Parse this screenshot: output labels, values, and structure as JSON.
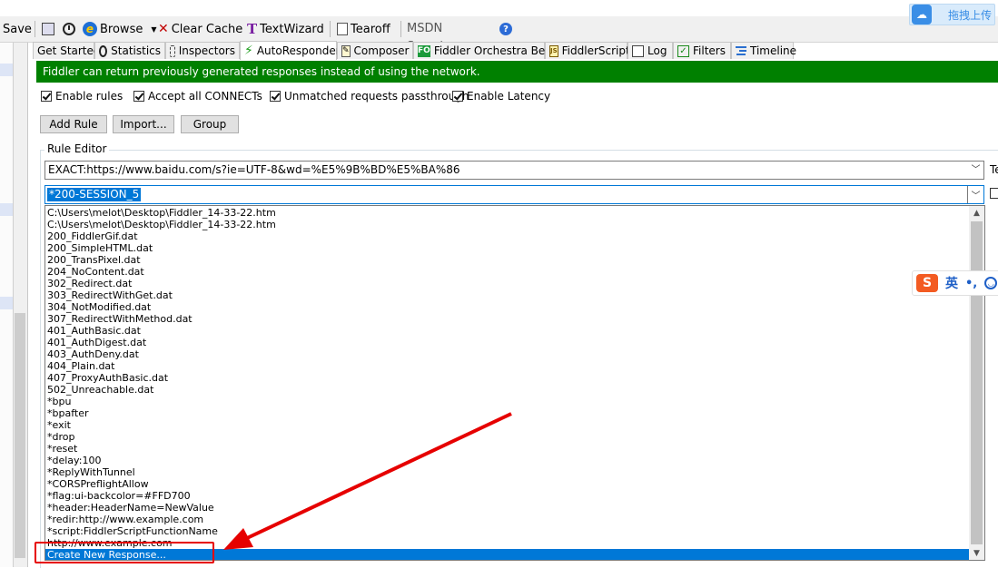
{
  "toolbar": {
    "save_label": "Save",
    "browse_label": "Browse",
    "clear_cache_label": "Clear Cache",
    "textwizard_label": "TextWizard",
    "tearoff_label": "Tearoff",
    "msdn_placeholder": "MSDN Search..."
  },
  "upload_label": "拖拽上传",
  "tabs": [
    {
      "label": "Get Started"
    },
    {
      "label": "Statistics"
    },
    {
      "label": "Inspectors"
    },
    {
      "label": "AutoResponder"
    },
    {
      "label": "Composer"
    },
    {
      "label": "Fiddler Orchestra Beta",
      "icon_text": "FO"
    },
    {
      "label": "FiddlerScript",
      "icon_text": "JS"
    },
    {
      "label": "Log"
    },
    {
      "label": "Filters"
    },
    {
      "label": "Timeline"
    }
  ],
  "banner": "Fiddler can return previously generated responses instead of using the network.",
  "options": {
    "enable_rules": {
      "label": "Enable rules",
      "checked": true
    },
    "accept_connects": {
      "label": "Accept all CONNECTs",
      "checked": true
    },
    "unmatched_passthrough": {
      "label": "Unmatched requests passthrough",
      "checked": true
    },
    "enable_latency": {
      "label": "Enable Latency",
      "checked": true
    }
  },
  "buttons": {
    "add_rule": "Add Rule",
    "import": "Import...",
    "group": "Group"
  },
  "rule_editor": {
    "label": "Rule Editor",
    "match_value": "EXACT:https://www.baidu.com/s?ie=UTF-8&wd=%E5%9B%BD%E5%BA%86",
    "side_fragment": "Te",
    "action_value": "*200-SESSION_5",
    "dropdown_items": [
      "C:\\Users\\melot\\Desktop\\Fiddler_14-33-22.htm",
      "C:\\Users\\melot\\Desktop\\Fiddler_14-33-22.htm",
      "200_FiddlerGif.dat",
      "200_SimpleHTML.dat",
      "200_TransPixel.dat",
      "204_NoContent.dat",
      "302_Redirect.dat",
      "303_RedirectWithGet.dat",
      "304_NotModified.dat",
      "307_RedirectWithMethod.dat",
      "401_AuthBasic.dat",
      "401_AuthDigest.dat",
      "403_AuthDeny.dat",
      "404_Plain.dat",
      "407_ProxyAuthBasic.dat",
      "502_Unreachable.dat",
      "*bpu",
      "*bpafter",
      "*exit",
      "*drop",
      "*reset",
      "*delay:100",
      "*ReplyWithTunnel",
      "*CORSPreflightAllow",
      "*flag:ui-backcolor=#FFD700",
      "*header:HeaderName=NewValue",
      "*redir:http://www.example.com",
      "*script:FiddlerScriptFunctionName",
      "http://www.example.com",
      "Create New Response..."
    ],
    "selected_index": 29
  },
  "ime": {
    "logo": "S",
    "mode": "英",
    "punct": "•,"
  },
  "colors": {
    "banner_green": "#008000",
    "selection_blue": "#0078d7",
    "annotation_red": "#e60000"
  }
}
